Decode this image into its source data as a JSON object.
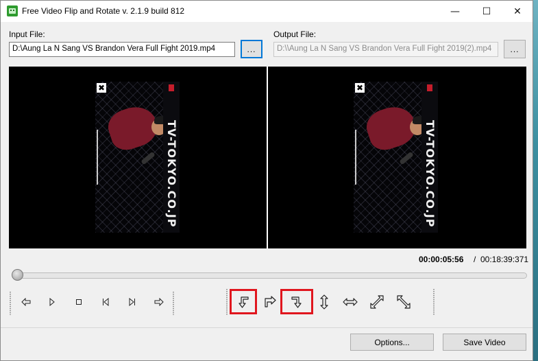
{
  "window": {
    "title": "Free Video Flip and Rotate  v. 2.1.9 build 812",
    "controls": {
      "minimize": "—",
      "maximize": "☐",
      "close": "✕"
    }
  },
  "input": {
    "label": "Input File:",
    "value": "D:\\Aung La N Sang VS Brandon Vera Full Fight 2019.mp4",
    "browse_label": "..."
  },
  "output": {
    "label": "Output File:",
    "value": "D:\\\\Aung La N Sang VS Brandon Vera Full Fight 2019(2).mp4",
    "browse_label": "..."
  },
  "preview": {
    "close_mark": "✖",
    "sign_text": "TV-TOKYO.CO.JP"
  },
  "playback": {
    "current_time": "00:00:05:56",
    "separator": "/",
    "total_time": "00:18:39:371",
    "seek_position": 0
  },
  "player_controls": [
    {
      "name": "step-back-button",
      "icon": "arrow-left-icon"
    },
    {
      "name": "play-button",
      "icon": "play-icon"
    },
    {
      "name": "stop-button",
      "icon": "stop-icon"
    },
    {
      "name": "prev-frame-button",
      "icon": "skip-back-icon"
    },
    {
      "name": "next-frame-button",
      "icon": "skip-forward-icon"
    },
    {
      "name": "step-forward-button",
      "icon": "arrow-right-icon"
    }
  ],
  "transform_controls": [
    {
      "name": "rotate-ccw-button",
      "icon": "rotate-left-icon",
      "highlighted": true
    },
    {
      "name": "rotate-cw-flip-button",
      "icon": "rotate-right-icon",
      "highlighted": false
    },
    {
      "name": "rotate-180-button",
      "icon": "rotate-down-icon",
      "highlighted": true
    },
    {
      "name": "flip-vertical-button",
      "icon": "flip-vertical-icon",
      "highlighted": false
    },
    {
      "name": "flip-horizontal-button",
      "icon": "flip-horizontal-icon",
      "highlighted": false
    },
    {
      "name": "transpose-button",
      "icon": "diagonal-arrow-icon",
      "highlighted": false
    },
    {
      "name": "transverse-button",
      "icon": "diagonal-arrow-reverse-icon",
      "highlighted": false
    }
  ],
  "footer": {
    "options_label": "Options...",
    "save_label": "Save Video"
  },
  "colors": {
    "accent": "#0078d7",
    "highlight": "#e0161e"
  }
}
